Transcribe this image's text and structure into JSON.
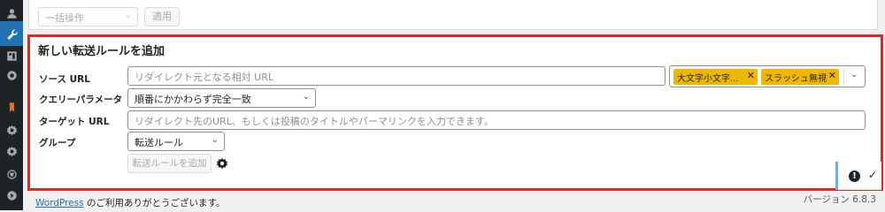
{
  "bulk": {
    "select_value": "一括操作",
    "apply_label": "適用"
  },
  "add_rule": {
    "title": "新しい転送ルールを追加",
    "source_url": {
      "label": "ソース URL",
      "placeholder": "リダイレクト元となる相対 URL",
      "tags": [
        {
          "label": "大文字小文字..."
        },
        {
          "label": "スラッシュ無視"
        }
      ]
    },
    "query_param": {
      "label": "クエリーパラメータ",
      "value": "順番にかかわらず完全一致"
    },
    "target_url": {
      "label": "ターゲット URL",
      "placeholder": "リダイレクト先のURL、もしくは投稿のタイトルやパーマリンクを入力できます。"
    },
    "group": {
      "label": "グループ",
      "value": "転送ルール"
    },
    "add_button": "転送ルールを追加"
  },
  "footer": {
    "link_text": "WordPress",
    "thanks_text": " のご利用ありがとうございます。",
    "version": "バージョン 6.8.3"
  },
  "colors": {
    "highlight_border": "#e8271c",
    "tag_bg": "#f0b700",
    "accent": "#2271b1"
  }
}
